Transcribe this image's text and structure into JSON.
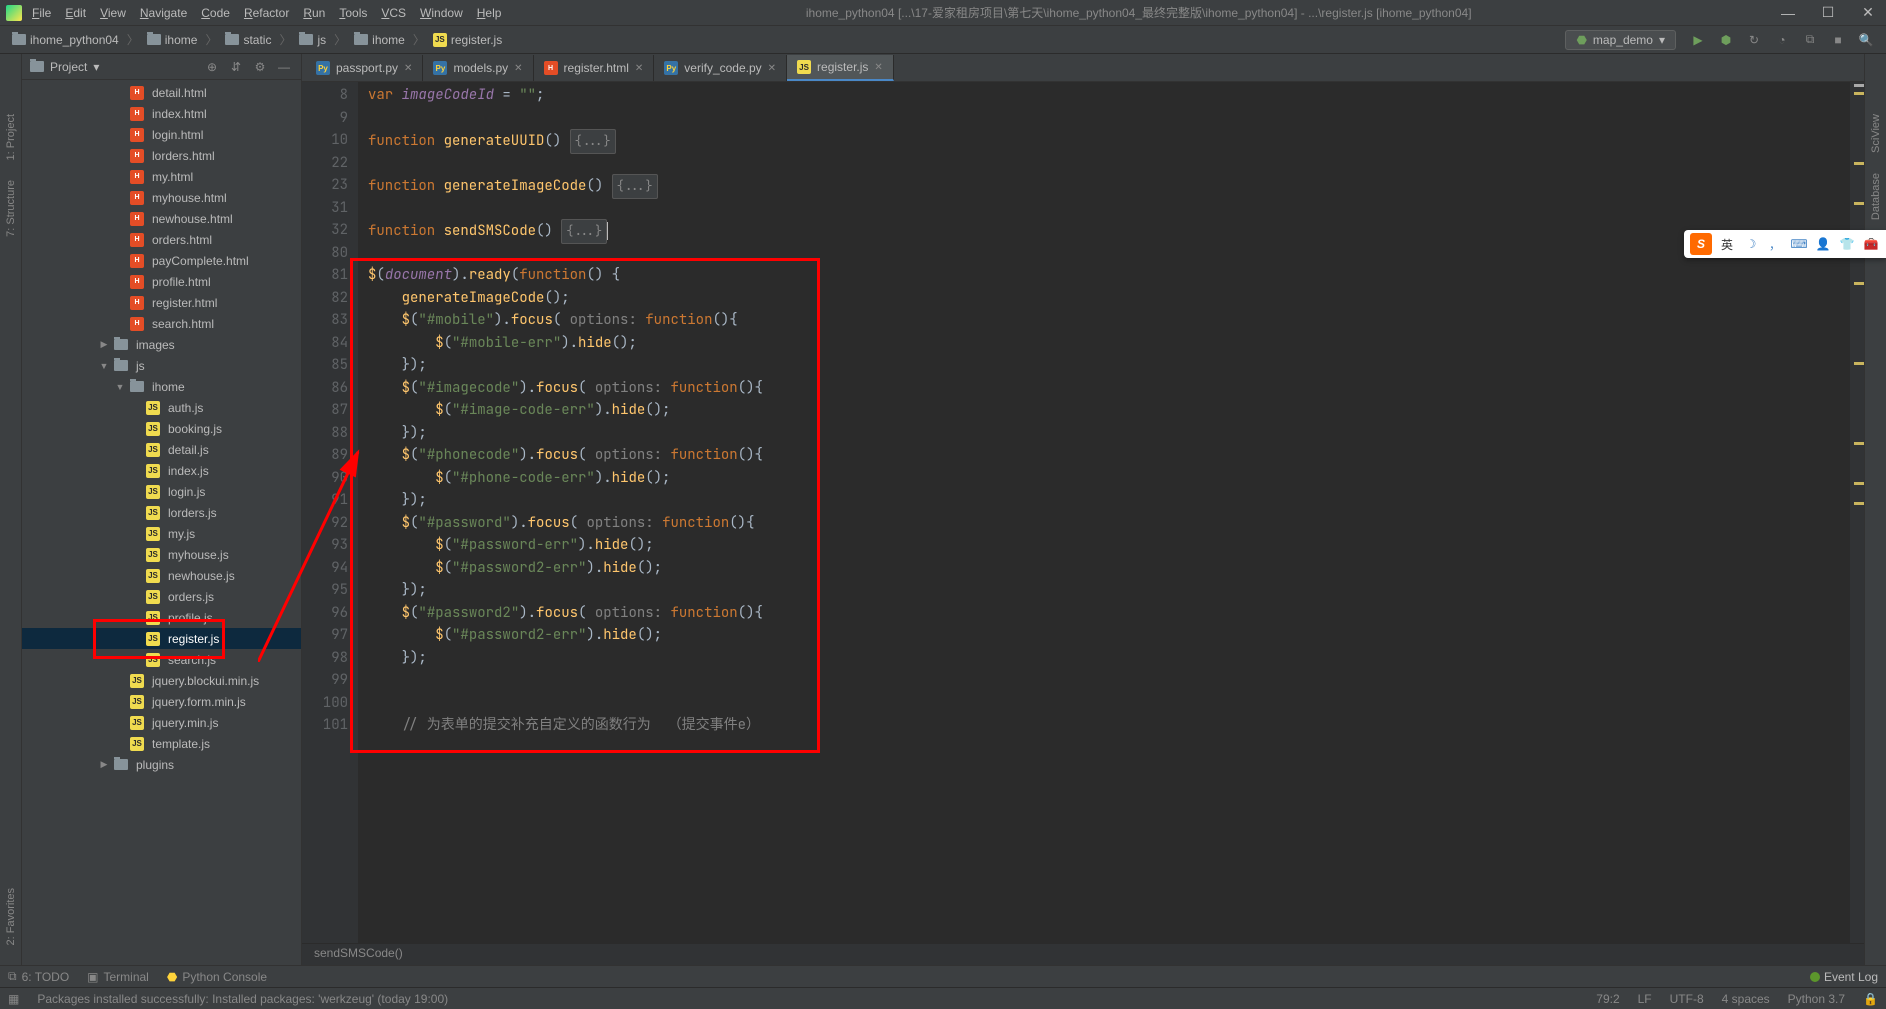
{
  "title": "ihome_python04 [...\\17-爱家租房项目\\第七天\\ihome_python04_最终完整版\\ihome_python04] - ...\\register.js [ihome_python04]",
  "menu": [
    "File",
    "Edit",
    "View",
    "Navigate",
    "Code",
    "Refactor",
    "Run",
    "Tools",
    "VCS",
    "Window",
    "Help"
  ],
  "breadcrumbs": [
    {
      "icon": "folder",
      "label": "ihome_python04"
    },
    {
      "icon": "folder",
      "label": "ihome"
    },
    {
      "icon": "folder",
      "label": "static"
    },
    {
      "icon": "folder",
      "label": "js"
    },
    {
      "icon": "folder",
      "label": "ihome"
    },
    {
      "icon": "js",
      "label": "register.js"
    }
  ],
  "run_config": "map_demo",
  "panel_title": "Project",
  "tree": [
    {
      "indent": 5,
      "icon": "html",
      "label": "detail.html",
      "chev": ""
    },
    {
      "indent": 5,
      "icon": "html",
      "label": "index.html",
      "chev": ""
    },
    {
      "indent": 5,
      "icon": "html",
      "label": "login.html",
      "chev": ""
    },
    {
      "indent": 5,
      "icon": "html",
      "label": "lorders.html",
      "chev": ""
    },
    {
      "indent": 5,
      "icon": "html",
      "label": "my.html",
      "chev": ""
    },
    {
      "indent": 5,
      "icon": "html",
      "label": "myhouse.html",
      "chev": ""
    },
    {
      "indent": 5,
      "icon": "html",
      "label": "newhouse.html",
      "chev": ""
    },
    {
      "indent": 5,
      "icon": "html",
      "label": "orders.html",
      "chev": ""
    },
    {
      "indent": 5,
      "icon": "html",
      "label": "payComplete.html",
      "chev": ""
    },
    {
      "indent": 5,
      "icon": "html",
      "label": "profile.html",
      "chev": ""
    },
    {
      "indent": 5,
      "icon": "html",
      "label": "register.html",
      "chev": ""
    },
    {
      "indent": 5,
      "icon": "html",
      "label": "search.html",
      "chev": ""
    },
    {
      "indent": 4,
      "icon": "folder",
      "label": "images",
      "chev": "▶"
    },
    {
      "indent": 4,
      "icon": "folder",
      "label": "js",
      "chev": "▼"
    },
    {
      "indent": 5,
      "icon": "folder",
      "label": "ihome",
      "chev": "▼"
    },
    {
      "indent": 6,
      "icon": "js",
      "label": "auth.js",
      "chev": ""
    },
    {
      "indent": 6,
      "icon": "js",
      "label": "booking.js",
      "chev": ""
    },
    {
      "indent": 6,
      "icon": "js",
      "label": "detail.js",
      "chev": ""
    },
    {
      "indent": 6,
      "icon": "js",
      "label": "index.js",
      "chev": ""
    },
    {
      "indent": 6,
      "icon": "js",
      "label": "login.js",
      "chev": ""
    },
    {
      "indent": 6,
      "icon": "js",
      "label": "lorders.js",
      "chev": ""
    },
    {
      "indent": 6,
      "icon": "js",
      "label": "my.js",
      "chev": ""
    },
    {
      "indent": 6,
      "icon": "js",
      "label": "myhouse.js",
      "chev": ""
    },
    {
      "indent": 6,
      "icon": "js",
      "label": "newhouse.js",
      "chev": ""
    },
    {
      "indent": 6,
      "icon": "js",
      "label": "orders.js",
      "chev": ""
    },
    {
      "indent": 6,
      "icon": "js",
      "label": "profile.js",
      "chev": ""
    },
    {
      "indent": 6,
      "icon": "js",
      "label": "register.js",
      "chev": "",
      "selected": true
    },
    {
      "indent": 6,
      "icon": "js",
      "label": "search.js",
      "chev": ""
    },
    {
      "indent": 5,
      "icon": "js",
      "label": "jquery.blockui.min.js",
      "chev": ""
    },
    {
      "indent": 5,
      "icon": "js",
      "label": "jquery.form.min.js",
      "chev": ""
    },
    {
      "indent": 5,
      "icon": "js",
      "label": "jquery.min.js",
      "chev": ""
    },
    {
      "indent": 5,
      "icon": "js",
      "label": "template.js",
      "chev": ""
    },
    {
      "indent": 4,
      "icon": "folder",
      "label": "plugins",
      "chev": "▶"
    }
  ],
  "tabs": [
    {
      "icon": "py",
      "label": "passport.py",
      "active": false
    },
    {
      "icon": "py",
      "label": "models.py",
      "active": false
    },
    {
      "icon": "html",
      "label": "register.html",
      "active": false
    },
    {
      "icon": "py",
      "label": "verify_code.py",
      "active": false
    },
    {
      "icon": "js",
      "label": "register.js",
      "active": true
    }
  ],
  "lines": [
    {
      "n": "8",
      "html": "<span class='kw'>var </span><span class='var'>imageCodeId</span><span class='par'> = </span><span class='str'>\"\"</span><span class='par'>;</span>"
    },
    {
      "n": "9",
      "html": ""
    },
    {
      "n": "10",
      "html": "<span class='kw'>function </span><span class='fn'>generateUUID</span><span class='par'>() </span><span class='fold'>{...}</span>"
    },
    {
      "n": "22",
      "html": ""
    },
    {
      "n": "23",
      "html": "<span class='kw'>function </span><span class='fn'>generateImageCode</span><span class='par'>() </span><span class='fold'>{...}</span>"
    },
    {
      "n": "31",
      "html": ""
    },
    {
      "n": "32",
      "html": "<span class='kw'>function </span><span class='fn'>sendSMSCode</span><span class='par'>() </span><span class='fold'>{...}</span><span class='cursor'></span>"
    },
    {
      "n": "80",
      "html": ""
    },
    {
      "n": "81",
      "html": "<span class='fn'>$</span><span class='par'>(</span><span class='var'>document</span><span class='par'>).</span><span class='fn'>ready</span><span class='par'>(</span><span class='kw'>function</span><span class='par'>() {</span>"
    },
    {
      "n": "82",
      "html": "    <span class='fn'>generateImageCode</span><span class='par'>();</span>"
    },
    {
      "n": "83",
      "html": "    <span class='fn'>$</span><span class='par'>(</span><span class='str'>\"#mobile\"</span><span class='par'>).</span><span class='fn'>focus</span><span class='par'>( </span><span class='gry'>options: </span><span class='kw'>function</span><span class='par'>(){</span>"
    },
    {
      "n": "84",
      "html": "        <span class='fn'>$</span><span class='par'>(</span><span class='str'>\"#mobile-err\"</span><span class='par'>).</span><span class='fn'>hide</span><span class='par'>();</span>"
    },
    {
      "n": "85",
      "html": "    <span class='par'>});</span>"
    },
    {
      "n": "86",
      "html": "    <span class='fn'>$</span><span class='par'>(</span><span class='str'>\"#imagecode\"</span><span class='par'>).</span><span class='fn'>focus</span><span class='par'>( </span><span class='gry'>options: </span><span class='kw'>function</span><span class='par'>(){</span>"
    },
    {
      "n": "87",
      "html": "        <span class='fn'>$</span><span class='par'>(</span><span class='str'>\"#image-code-err\"</span><span class='par'>).</span><span class='fn'>hide</span><span class='par'>();</span>"
    },
    {
      "n": "88",
      "html": "    <span class='par'>});</span>"
    },
    {
      "n": "89",
      "html": "    <span class='fn'>$</span><span class='par'>(</span><span class='str'>\"#phonecode\"</span><span class='par'>).</span><span class='fn'>focus</span><span class='par'>( </span><span class='gry'>options: </span><span class='kw'>function</span><span class='par'>(){</span>"
    },
    {
      "n": "90",
      "html": "        <span class='fn'>$</span><span class='par'>(</span><span class='str'>\"#phone-code-err\"</span><span class='par'>).</span><span class='fn'>hide</span><span class='par'>();</span>"
    },
    {
      "n": "91",
      "html": "    <span class='par'>});</span>"
    },
    {
      "n": "92",
      "html": "    <span class='fn'>$</span><span class='par'>(</span><span class='str'>\"#password\"</span><span class='par'>).</span><span class='fn'>focus</span><span class='par'>( </span><span class='gry'>options: </span><span class='kw'>function</span><span class='par'>(){</span>"
    },
    {
      "n": "93",
      "html": "        <span class='fn'>$</span><span class='par'>(</span><span class='str'>\"#password-err\"</span><span class='par'>).</span><span class='fn'>hide</span><span class='par'>();</span>"
    },
    {
      "n": "94",
      "html": "        <span class='fn'>$</span><span class='par'>(</span><span class='str'>\"#password2-err\"</span><span class='par'>).</span><span class='fn'>hide</span><span class='par'>();</span>"
    },
    {
      "n": "95",
      "html": "    <span class='par'>});</span>"
    },
    {
      "n": "96",
      "html": "    <span class='fn'>$</span><span class='par'>(</span><span class='str'>\"#password2\"</span><span class='par'>).</span><span class='fn'>focus</span><span class='par'>( </span><span class='gry'>options: </span><span class='kw'>function</span><span class='par'>(){</span>"
    },
    {
      "n": "97",
      "html": "        <span class='fn'>$</span><span class='par'>(</span><span class='str'>\"#password2-err\"</span><span class='par'>).</span><span class='fn'>hide</span><span class='par'>();</span>"
    },
    {
      "n": "98",
      "html": "    <span class='par'>});</span>"
    },
    {
      "n": "99",
      "html": ""
    },
    {
      "n": "100",
      "html": ""
    },
    {
      "n": "101",
      "html": "    <span class='cmt'>// 为表单的提交补充自定义的函数行为  （提交事件e）</span>"
    }
  ],
  "fn_breadcrumb": "sendSMSCode()",
  "bottom_tools": {
    "todo": "6: TODO",
    "terminal": "Terminal",
    "python_console": "Python Console"
  },
  "event_log": "Event Log",
  "status_msg": "Packages installed successfully: Installed packages: 'werkzeug' (today 19:00)",
  "status": {
    "pos": "79:2",
    "eol": "LF",
    "enc": "UTF-8",
    "indent": "4 spaces",
    "py": "Python 3.7"
  },
  "rail_left": [
    "1: Project",
    "7: Structure",
    "2: Favorites"
  ],
  "rail_right": [
    "SciView",
    "Database"
  ],
  "ime_label": "英"
}
